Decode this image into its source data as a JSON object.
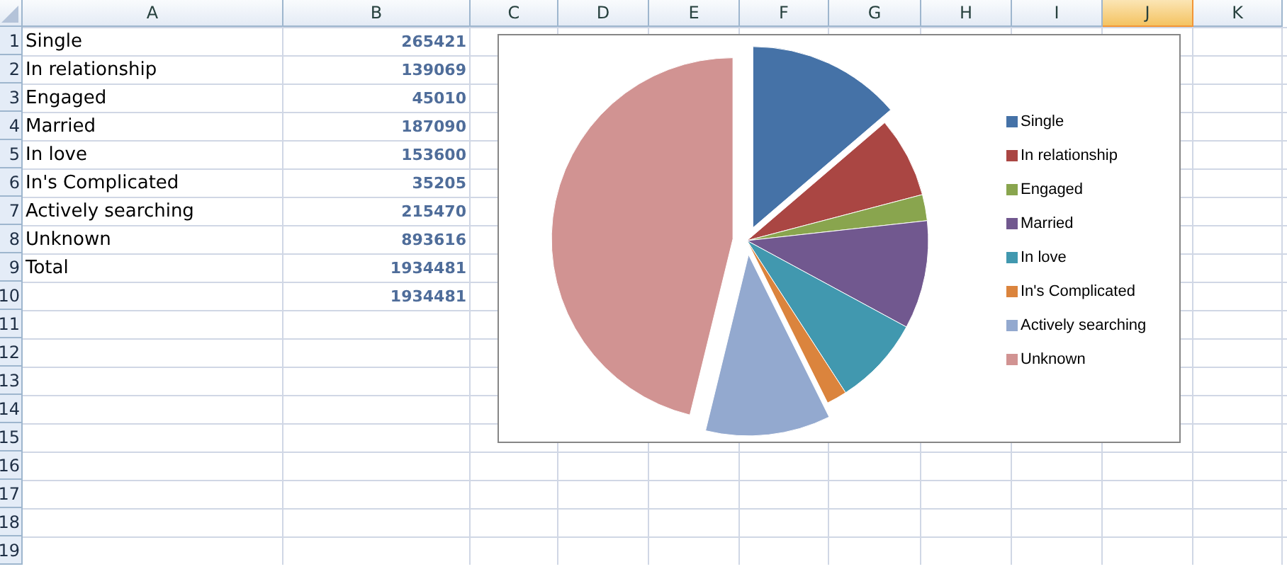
{
  "columns": [
    {
      "label": "A",
      "selected": false
    },
    {
      "label": "B",
      "selected": false
    },
    {
      "label": "C",
      "selected": false
    },
    {
      "label": "D",
      "selected": false
    },
    {
      "label": "E",
      "selected": false
    },
    {
      "label": "F",
      "selected": false
    },
    {
      "label": "G",
      "selected": false
    },
    {
      "label": "H",
      "selected": false
    },
    {
      "label": "I",
      "selected": false
    },
    {
      "label": "J",
      "selected": true
    },
    {
      "label": "K",
      "selected": false
    }
  ],
  "rows": [
    {
      "number": "1",
      "a": "Single",
      "b": "265421"
    },
    {
      "number": "2",
      "a": "In relationship",
      "b": "139069"
    },
    {
      "number": "3",
      "a": "Engaged",
      "b": "45010"
    },
    {
      "number": "4",
      "a": "Married",
      "b": "187090"
    },
    {
      "number": "5",
      "a": "In love",
      "b": "153600"
    },
    {
      "number": "6",
      "a": "In's Complicated",
      "b": "35205"
    },
    {
      "number": "7",
      "a": "Actively searching",
      "b": "215470"
    },
    {
      "number": "8",
      "a": "Unknown",
      "b": "893616"
    },
    {
      "number": "9",
      "a": "Total",
      "b": "1934481"
    },
    {
      "number": "10",
      "b": "1934481"
    },
    {
      "number": "11"
    },
    {
      "number": "12"
    },
    {
      "number": "13"
    },
    {
      "number": "14"
    },
    {
      "number": "15"
    },
    {
      "number": "16"
    },
    {
      "number": "17"
    },
    {
      "number": "18"
    },
    {
      "number": "19"
    }
  ],
  "chart": {
    "chart_data": {
      "type": "pie",
      "categories": [
        "Single",
        "In relationship",
        "Engaged",
        "Married",
        "In love",
        "In's Complicated",
        "Actively searching",
        "Unknown"
      ],
      "series": [
        {
          "values": [
            13.72,
            7.19,
            2.33,
            9.67,
            7.94,
            1.82,
            11.14,
            46.19
          ]
        }
      ]
    },
    "slices": [
      {
        "color": "#4572a7",
        "exploded": true
      },
      {
        "color": "#aa4643",
        "exploded": false
      },
      {
        "color": "#89a54e",
        "exploded": false
      },
      {
        "color": "#71588f",
        "exploded": false
      },
      {
        "color": "#4198af",
        "exploded": false
      },
      {
        "color": "#db843d",
        "exploded": false
      },
      {
        "color": "#93a9cf",
        "exploded": true
      },
      {
        "color": "#d19392",
        "exploded": true
      }
    ]
  }
}
